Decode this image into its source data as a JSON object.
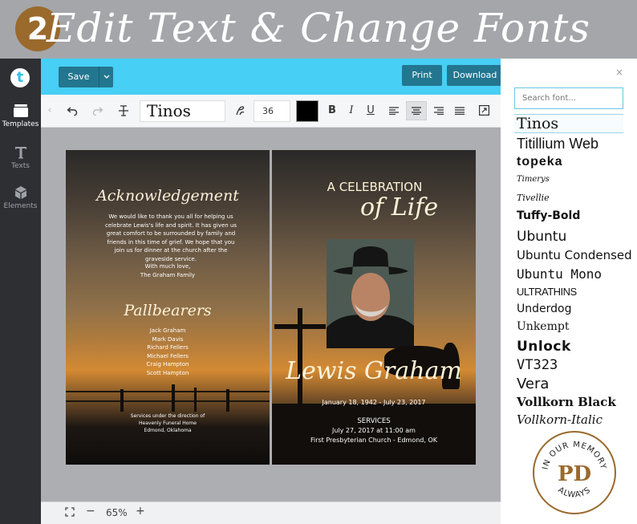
{
  "banner": {
    "step_number": "2",
    "title": "Edit Text & Change Fonts"
  },
  "sidebar": {
    "items": [
      {
        "label": "Templates",
        "icon": "templates-icon",
        "active": true
      },
      {
        "label": "Texts",
        "icon": "text-icon",
        "active": false
      },
      {
        "label": "Elements",
        "icon": "elements-icon",
        "active": false
      }
    ]
  },
  "header": {
    "save_label": "Save",
    "print_label": "Print",
    "download_label": "Download"
  },
  "toolbar": {
    "font_name": "Tinos",
    "font_size": "36",
    "text_color": "#000000"
  },
  "left_page": {
    "heading": "Acknowledgement",
    "message": "We would like to thank you all for helping us celebrate Lewis's life and spirit. It has given us great comfort to be surrounded by family and friends in this time of grief. We hope that you join us for dinner at the church after the graveside service.",
    "signoff_1": "With much love,",
    "signoff_2": "The Graham Family",
    "pallbearers_heading": "Pallbearers",
    "pallbearers": [
      "Jack Graham",
      "Mark Davis",
      "Richard Fellers",
      "Michael Fellers",
      "Craig Hampton",
      "Scott Hampton"
    ],
    "services_note_1": "Services under the direction of",
    "services_note_2": "Heavenly Funeral Home",
    "services_note_3": "Edmond, Oklahoma"
  },
  "right_page": {
    "celebration": "A CELEBRATION",
    "of_life": "of Life",
    "name": "Lewis Graham",
    "dates": "January 18, 1942 - July 23, 2017",
    "services_label": "SERVICES",
    "service_time": "July 27, 2017 at 11:00 am",
    "service_place": "First Presbyterian Church - Edmond, OK"
  },
  "zoom": {
    "level": "65%",
    "minus": "−",
    "plus": "+"
  },
  "font_panel": {
    "search_placeholder": "Search font...",
    "fonts": [
      "Tinos",
      "Titillium Web",
      "topeka",
      "Timerys",
      "Tivellie",
      "Tuffy-Bold",
      "Ubuntu",
      "Ubuntu Condensed",
      "Ubuntu Mono",
      "ULTRATHINS",
      "Underdog",
      "Unkempt",
      "Unlock",
      "VT323",
      "Vera",
      "Vollkorn Black",
      "Vollkorn-Italic"
    ]
  },
  "seal": {
    "top_text": "IN OUR MEMORY",
    "bottom_text": "ALWAYS",
    "monogram": "PD",
    "color": "#9a6a2c"
  },
  "colors": {
    "accent": "#47cff5",
    "button": "#23768f",
    "sidebar": "#2d2f33"
  }
}
